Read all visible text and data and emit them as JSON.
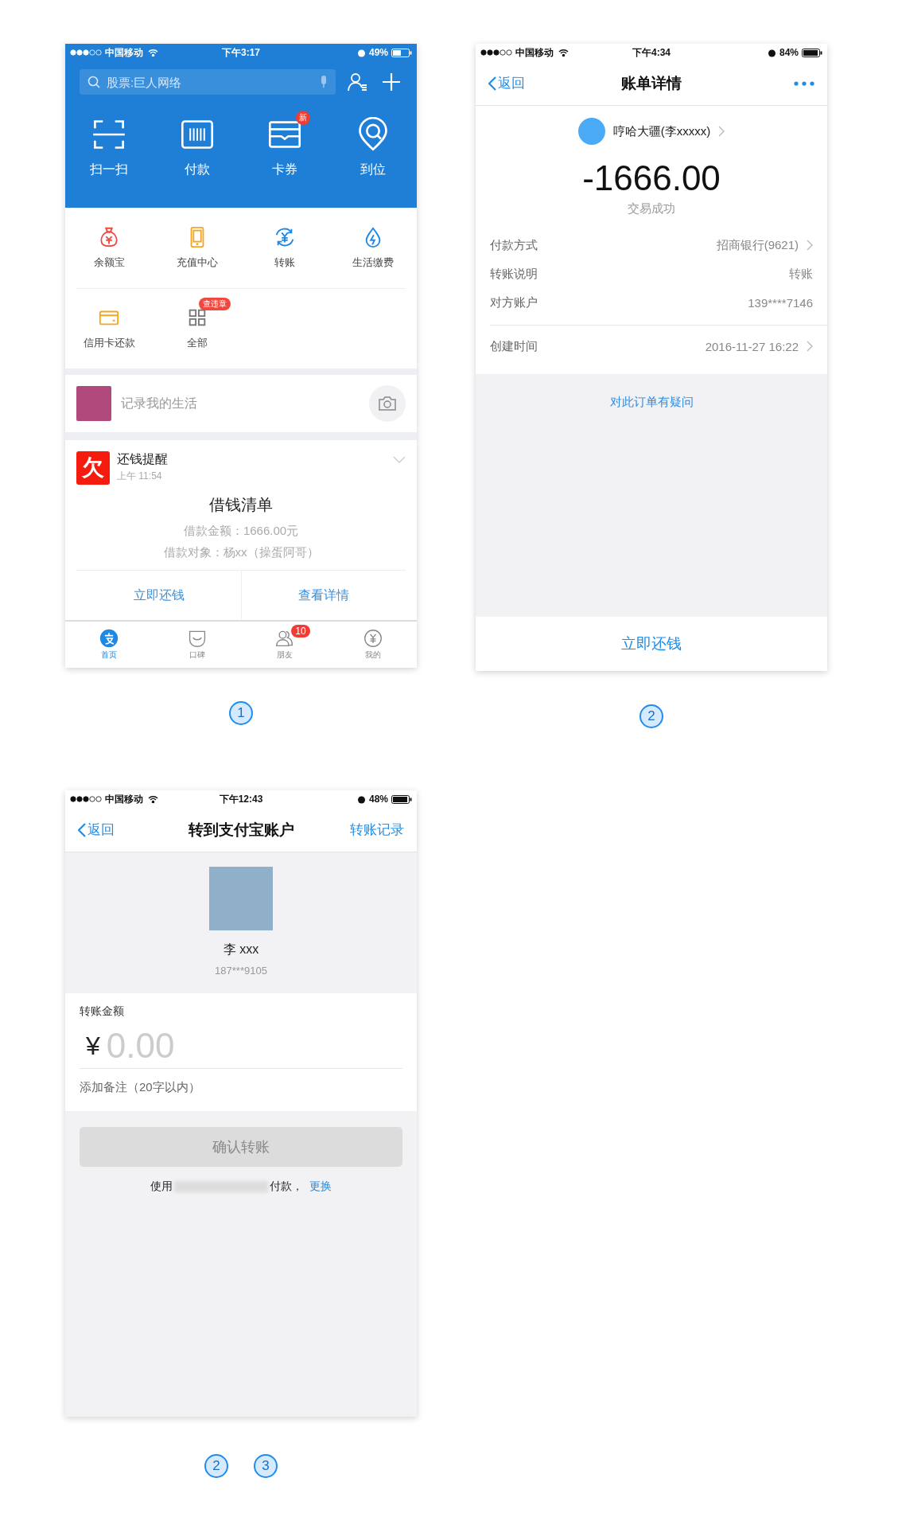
{
  "screen_home": {
    "markers": [
      "1"
    ],
    "status_bar": {
      "carrier": "中国移动",
      "time": "下午3:17",
      "battery": "49%"
    },
    "search": {
      "placeholder": "股票:巨人网络"
    },
    "quick_actions": [
      {
        "kind": "scan",
        "label": "扫一扫"
      },
      {
        "kind": "barcode",
        "label": "付款"
      },
      {
        "kind": "card",
        "label": "卡券",
        "badge": "新"
      },
      {
        "kind": "pin",
        "label": "到位"
      }
    ],
    "apps": [
      {
        "kind": "moneybag",
        "label": "余额宝"
      },
      {
        "kind": "phone",
        "label": "充值中心"
      },
      {
        "kind": "transfer",
        "label": "转账"
      },
      {
        "kind": "drop",
        "label": "生活缴费"
      },
      {
        "kind": "creditcard",
        "label": "信用卡还款"
      },
      {
        "kind": "grid",
        "label": "全部",
        "badge": "查违章"
      }
    ],
    "life_post": {
      "placeholder": "记录我的生活"
    },
    "reminder": {
      "app_icon": "欠",
      "title": "还钱提醒",
      "time": "上午 11:54",
      "heading": "借钱清单",
      "lines": [
        "借款金额：1666.00元",
        "借款对象：杨xx（操蛋阿哥）"
      ],
      "actions": [
        "立即还钱",
        "查看详情"
      ]
    },
    "tab_bar": [
      {
        "kind": "home",
        "label": "首页",
        "selected": true
      },
      {
        "kind": "koubei",
        "label": "口碑",
        "selected": false
      },
      {
        "kind": "friends",
        "label": "朋友",
        "selected": false,
        "badge": "10"
      },
      {
        "kind": "mine",
        "label": "我的",
        "selected": false
      }
    ]
  },
  "screen_bill_detail": {
    "markers": [
      "2"
    ],
    "status_bar": {
      "carrier": "中国移动",
      "time": "下午4:34",
      "battery": "84%"
    },
    "nav": {
      "back": "返回",
      "title": "账单详情"
    },
    "payee": "哼哈大疆(李xxxxx)",
    "amount": "-1666.00",
    "status": "交易成功",
    "details": [
      {
        "label": "付款方式",
        "value": "招商银行(9621)",
        "has_arrow": true
      },
      {
        "label": "转账说明",
        "value": "转账",
        "has_arrow": false
      },
      {
        "label": "对方账户",
        "value": "139****7146",
        "has_arrow": false
      }
    ],
    "created": {
      "label": "创建时间",
      "value": "2016-11-27 16:22",
      "has_arrow": true
    },
    "question_link": "对此订单有疑问",
    "repay_button": "立即还钱"
  },
  "screen_transfer": {
    "markers": [
      "2",
      "3"
    ],
    "status_bar": {
      "carrier": "中国移动",
      "time": "下午12:43",
      "battery": "48%"
    },
    "nav": {
      "back": "返回",
      "title": "转到支付宝账户",
      "action": "转账记录"
    },
    "recipient": {
      "name": "李 xxx",
      "account": "187***9105"
    },
    "amount_label": "转账金额",
    "currency": "¥",
    "amount": {
      "placeholder": "0.00"
    },
    "note": {
      "placeholder": "添加备注（20字以内）"
    },
    "confirm_button": {
      "label": "确认转账",
      "disabled": true
    },
    "payment_note": {
      "prefix": "使用",
      "suffix": "付款，",
      "link": "更换"
    }
  }
}
